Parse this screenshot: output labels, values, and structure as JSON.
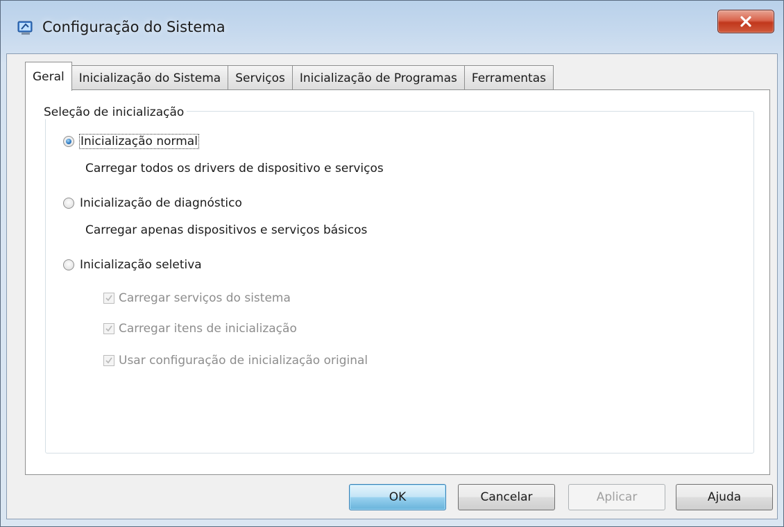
{
  "window": {
    "title": "Configuração do Sistema",
    "close_label": "close"
  },
  "tabs": [
    {
      "label": "Geral",
      "active": true
    },
    {
      "label": "Inicialização do Sistema",
      "active": false
    },
    {
      "label": "Serviços",
      "active": false
    },
    {
      "label": "Inicialização de Programas",
      "active": false
    },
    {
      "label": "Ferramentas",
      "active": false
    }
  ],
  "startup_selection": {
    "legend": "Seleção de inicialização",
    "options": [
      {
        "label": "Inicialização normal",
        "description": "Carregar todos os drivers de dispositivo e serviços",
        "selected": true
      },
      {
        "label": "Inicialização de diagnóstico",
        "description": "Carregar apenas dispositivos e serviços básicos",
        "selected": false
      },
      {
        "label": "Inicialização seletiva",
        "selected": false
      }
    ],
    "selective_checks": [
      {
        "label": "Carregar serviços do sistema",
        "checked": true,
        "enabled": false
      },
      {
        "label": "Carregar itens de inicialização",
        "checked": true,
        "enabled": false
      },
      {
        "label": "Usar configuração de inicialização original",
        "checked": true,
        "enabled": false
      }
    ]
  },
  "buttons": {
    "ok": "OK",
    "cancel": "Cancelar",
    "apply": "Aplicar",
    "help": "Ajuda"
  },
  "colors": {
    "accent": "#2b78c2",
    "close_button": "#c1371c",
    "disabled_text": "#8d8d8d"
  }
}
